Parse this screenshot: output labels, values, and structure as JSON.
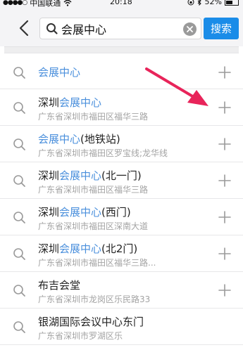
{
  "status_bar": {
    "signal_dots": "●●●●○",
    "carrier": "中国联通",
    "time": "20:18",
    "battery": "52%"
  },
  "search": {
    "query": "会展中心",
    "button_label": "搜索"
  },
  "results": [
    {
      "title_pre": "",
      "title_hl": "会展中心",
      "title_post": "",
      "subtitle": ""
    },
    {
      "title_pre": "深圳",
      "title_hl": "会展中心",
      "title_post": "",
      "subtitle": "广东省深圳市福田区福华三路"
    },
    {
      "title_pre": "",
      "title_hl": "会展中心",
      "title_post": "(地铁站)",
      "subtitle": "广东省深圳市福田区罗宝线;龙华线"
    },
    {
      "title_pre": "深圳",
      "title_hl": "会展中心",
      "title_post": "(北一门)",
      "subtitle": "广东省深圳市福田区福华三路"
    },
    {
      "title_pre": "深圳",
      "title_hl": "会展中心",
      "title_post": "(西门)",
      "subtitle": "广东省深圳市福田区深南大道"
    },
    {
      "title_pre": "深圳",
      "title_hl": "会展中心",
      "title_post": "(北2门)",
      "subtitle": "广东省深圳市福田区福华三路..."
    },
    {
      "title_pre": "布吉会堂",
      "title_hl": "",
      "title_post": "",
      "subtitle": "广东省深圳市龙岗区乐民路33"
    },
    {
      "title_pre": "银湖国际会议中",
      "title_hl": "",
      "title_post": "心东门",
      "subtitle": "广东省深圳市罗湖区乐"
    }
  ],
  "colors": {
    "accent": "#1a8ce8",
    "highlight": "#4a8fdc",
    "annotation_arrow": "#e8245a"
  },
  "icons": {
    "back": "chevron-left-icon",
    "search": "search-icon",
    "clear": "clear-icon",
    "add": "plus-icon"
  }
}
